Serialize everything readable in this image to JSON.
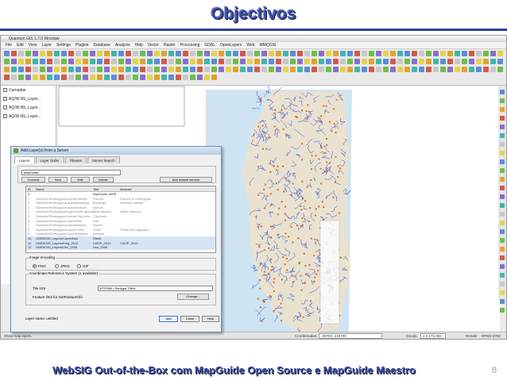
{
  "slide": {
    "title": "Objectivos",
    "footer": "WebSIG Out-of-the-Box com MapGuide Open Source e MapGuide Maestro",
    "page_number": "8"
  },
  "app": {
    "window_title": "Quantum GIS 1.7.0 Wroclaw",
    "menus": [
      "File",
      "Edit",
      "View",
      "Layer",
      "Settings",
      "Plugins",
      "Database",
      "Analysis",
      "Help",
      "Vector",
      "Raster",
      "Processing",
      "GDAL",
      "OpenLayers",
      "Web",
      "MMQGIS"
    ],
    "layers": [
      {
        "label": "Camadas"
      },
      {
        "label": "AQ/W.NS_Layer..."
      },
      {
        "label": "AQ/W.NS_Layer..."
      },
      {
        "label": "AQ/W.NS_Layer..."
      }
    ],
    "status": {
      "message": "Show map layers",
      "coord_label": "Coordenadas:",
      "coord_value": "-38700,-218700",
      "scale_label": "Escala",
      "scale_value": "1:4.173.063",
      "render_label": "Render",
      "epsg": "EPSG:3763"
    }
  },
  "dialog": {
    "title": "Add Layer(s) from a Server",
    "tabs": [
      "Layers",
      "Layer Order",
      "Tilesets",
      "Server Search"
    ],
    "server_select": "MapGuide",
    "buttons": {
      "connect": "Connect",
      "new": "New",
      "edit": "Edit",
      "delete": "Delete",
      "add_default": "Add default servers"
    },
    "table_headers": [
      "ID",
      "Name",
      "Title",
      "Abstract"
    ],
    "table_rows": [
      {
        "id": "0",
        "name": "",
        "title": "MapGuide WMS",
        "abstract": ""
      },
      {
        "id": "1",
        "name": "Samples/Sheboygan/Layers/Parcels",
        "title": "Parcels",
        "abstract": "Parcels of Sheboygan"
      },
      {
        "id": "2",
        "name": "Samples/Sheboygan/Layers/Buildings",
        "title": "Buildings",
        "abstract": "Building outlines"
      },
      {
        "id": "3",
        "name": "Samples/Sheboygan/Layers/Islands",
        "title": "Islands",
        "abstract": ""
      },
      {
        "id": "4",
        "name": "Samples/Sheboygan/Layers/Hydrography",
        "title": "Hydrography",
        "abstract": "Water features"
      },
      {
        "id": "5",
        "name": "Samples/Sheboygan/Layers/CityLimits",
        "title": "CityLimits",
        "abstract": ""
      },
      {
        "id": "6",
        "name": "Samples/Sheboygan/Layers/Rail",
        "title": "Rail",
        "abstract": ""
      },
      {
        "id": "7",
        "name": "Samples/Sheboygan/Layers/Roads",
        "title": "Roads",
        "abstract": ""
      },
      {
        "id": "8",
        "name": "Samples/Sheboygan/Layers/Trees",
        "title": "Trees",
        "abstract": "Trees and vegetation"
      },
      {
        "id": "9",
        "name": "Samples/Sheboygan/Layers/Districts",
        "title": "Districts",
        "abstract": ""
      },
      {
        "id": "10",
        "name": "UNSW.NS_Layers/Concelhos",
        "title": "Distrit",
        "abstract": ""
      },
      {
        "id": "11",
        "name": "UNSW.NS_Layers/Freg_2012",
        "title": "CAOP_2012",
        "abstract": "CAOP_2012"
      },
      {
        "id": "12",
        "name": "UNSW.NS_Layers/Uso_2006",
        "title": "Uso_2006",
        "abstract": ""
      }
    ],
    "image_encoding_label": "Image encoding",
    "formats": [
      "PNG",
      "JPEG",
      "GIF"
    ],
    "selected_format": "PNG",
    "crs_group": "Coordinate Reference System (1 available)",
    "crs_value": "ETRS89 / Portugal TM06",
    "crs_button": "Change...",
    "layer_name_label": "Layer name",
    "layer_name_value": "untitled",
    "tile_size_label": "Tile size",
    "feature_limit_label": "Feature limit for GetFeatureInfo",
    "add_button": "Add",
    "close_button": "Close",
    "help_button": "Help"
  },
  "colors": {
    "title": "#3a4fb0",
    "rule": "#2f3f95",
    "map_sea": "#cfe4f2",
    "map_land": "#e9e2d0",
    "map_lines": "#2d4fd9",
    "map_points": "#e06a1a"
  }
}
